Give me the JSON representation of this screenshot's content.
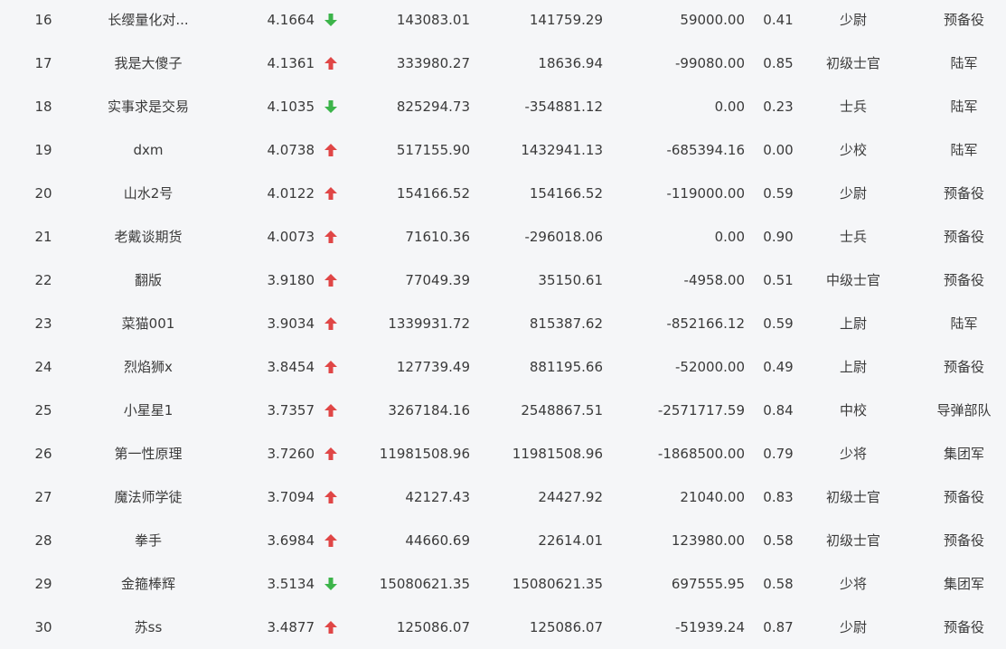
{
  "colors": {
    "up": "#e04646",
    "down": "#3cb44a",
    "text": "#3a3a3a",
    "background": "#f5f6f8"
  },
  "rows": [
    {
      "rank": "16",
      "name": "长缨量化对...",
      "score": "4.1664",
      "trend": "down",
      "v1": "143083.01",
      "v2": "141759.29",
      "v3": "59000.00",
      "ratio": "0.41",
      "rank_title": "少尉",
      "unit": "预备役"
    },
    {
      "rank": "17",
      "name": "我是大傻子",
      "score": "4.1361",
      "trend": "up",
      "v1": "333980.27",
      "v2": "18636.94",
      "v3": "-99080.00",
      "ratio": "0.85",
      "rank_title": "初级士官",
      "unit": "陆军"
    },
    {
      "rank": "18",
      "name": "实事求是交易",
      "score": "4.1035",
      "trend": "down",
      "v1": "825294.73",
      "v2": "-354881.12",
      "v3": "0.00",
      "ratio": "0.23",
      "rank_title": "士兵",
      "unit": "陆军"
    },
    {
      "rank": "19",
      "name": "dxm",
      "score": "4.0738",
      "trend": "up",
      "v1": "517155.90",
      "v2": "1432941.13",
      "v3": "-685394.16",
      "ratio": "0.00",
      "rank_title": "少校",
      "unit": "陆军"
    },
    {
      "rank": "20",
      "name": "山水2号",
      "score": "4.0122",
      "trend": "up",
      "v1": "154166.52",
      "v2": "154166.52",
      "v3": "-119000.00",
      "ratio": "0.59",
      "rank_title": "少尉",
      "unit": "预备役"
    },
    {
      "rank": "21",
      "name": "老戴谈期货",
      "score": "4.0073",
      "trend": "up",
      "v1": "71610.36",
      "v2": "-296018.06",
      "v3": "0.00",
      "ratio": "0.90",
      "rank_title": "士兵",
      "unit": "预备役"
    },
    {
      "rank": "22",
      "name": "翻版",
      "score": "3.9180",
      "trend": "up",
      "v1": "77049.39",
      "v2": "35150.61",
      "v3": "-4958.00",
      "ratio": "0.51",
      "rank_title": "中级士官",
      "unit": "预备役"
    },
    {
      "rank": "23",
      "name": "菜猫001",
      "score": "3.9034",
      "trend": "up",
      "v1": "1339931.72",
      "v2": "815387.62",
      "v3": "-852166.12",
      "ratio": "0.59",
      "rank_title": "上尉",
      "unit": "陆军"
    },
    {
      "rank": "24",
      "name": "烈焰狮x",
      "score": "3.8454",
      "trend": "up",
      "v1": "127739.49",
      "v2": "881195.66",
      "v3": "-52000.00",
      "ratio": "0.49",
      "rank_title": "上尉",
      "unit": "预备役"
    },
    {
      "rank": "25",
      "name": "小星星1",
      "score": "3.7357",
      "trend": "up",
      "v1": "3267184.16",
      "v2": "2548867.51",
      "v3": "-2571717.59",
      "ratio": "0.84",
      "rank_title": "中校",
      "unit": "导弹部队"
    },
    {
      "rank": "26",
      "name": "第一性原理",
      "score": "3.7260",
      "trend": "up",
      "v1": "11981508.96",
      "v2": "11981508.96",
      "v3": "-1868500.00",
      "ratio": "0.79",
      "rank_title": "少将",
      "unit": "集团军"
    },
    {
      "rank": "27",
      "name": "魔法师学徒",
      "score": "3.7094",
      "trend": "up",
      "v1": "42127.43",
      "v2": "24427.92",
      "v3": "21040.00",
      "ratio": "0.83",
      "rank_title": "初级士官",
      "unit": "预备役"
    },
    {
      "rank": "28",
      "name": "拳手",
      "score": "3.6984",
      "trend": "up",
      "v1": "44660.69",
      "v2": "22614.01",
      "v3": "123980.00",
      "ratio": "0.58",
      "rank_title": "初级士官",
      "unit": "预备役"
    },
    {
      "rank": "29",
      "name": "金箍棒辉",
      "score": "3.5134",
      "trend": "down",
      "v1": "15080621.35",
      "v2": "15080621.35",
      "v3": "697555.95",
      "ratio": "0.58",
      "rank_title": "少将",
      "unit": "集团军"
    },
    {
      "rank": "30",
      "name": "苏ss",
      "score": "3.4877",
      "trend": "up",
      "v1": "125086.07",
      "v2": "125086.07",
      "v3": "-51939.24",
      "ratio": "0.87",
      "rank_title": "少尉",
      "unit": "预备役"
    }
  ]
}
